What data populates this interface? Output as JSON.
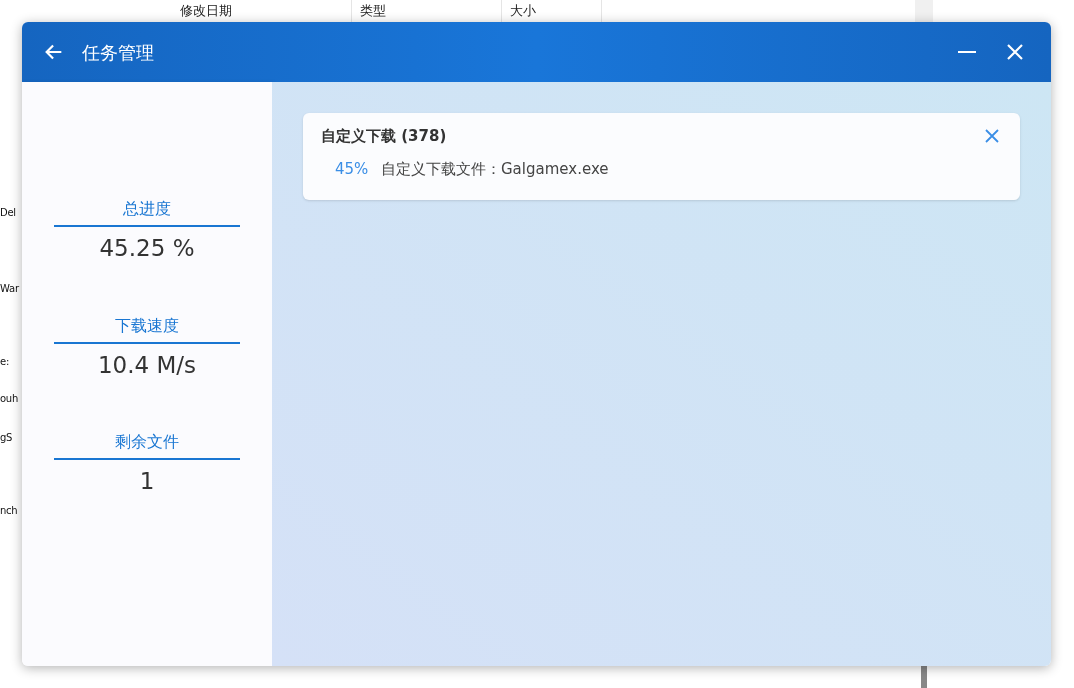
{
  "background_window": {
    "columns": [
      "修改日期",
      "类型",
      "大小"
    ],
    "row_fragments": [
      "Del",
      "War",
      "e:",
      "ouh",
      "gS",
      "nch"
    ]
  },
  "window": {
    "title": "任务管理"
  },
  "stats": [
    {
      "label": "总进度",
      "value": "45.25 %"
    },
    {
      "label": "下载速度",
      "value": "10.4 M/s"
    },
    {
      "label": "剩余文件",
      "value": "1"
    }
  ],
  "tasks": [
    {
      "title": "自定义下载 (378)",
      "files": [
        {
          "percent": "45%",
          "name": "自定义下载文件：Galgamex.exe"
        }
      ]
    }
  ]
}
